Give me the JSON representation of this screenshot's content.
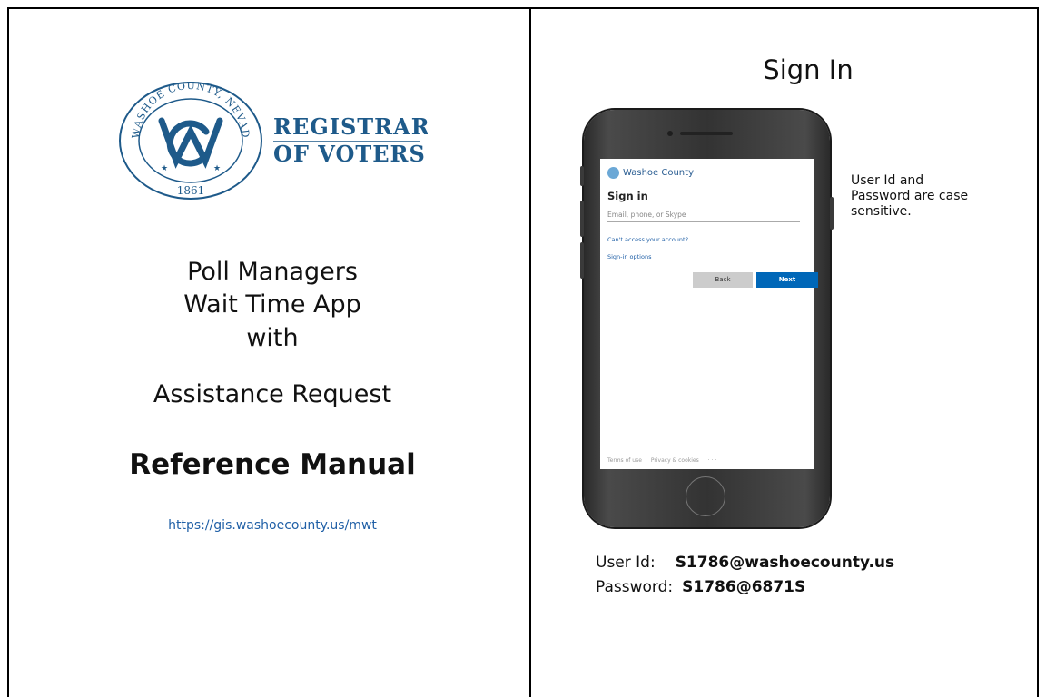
{
  "left_panel": {
    "logo": {
      "arc_text": "WASHOE COUNTY, NEVADA",
      "year": "1861",
      "org_line1": "REGISTRAR",
      "org_line2": "OF VOTERS",
      "brand_color": "#1e5a8a"
    },
    "title_lines": [
      "Poll Managers",
      "Wait Time App",
      "with",
      "Assistance Request"
    ],
    "subtitle": "Reference Manual",
    "url": "https://gis.washoecounty.us/mwt"
  },
  "right_panel": {
    "heading": "Sign In",
    "note": "User Id and Password are case sensitive.",
    "phone_screen": {
      "org": "Washoe County",
      "heading": "Sign in",
      "input_placeholder": "Email, phone, or Skype",
      "link_cant_access": "Can't access your account?",
      "link_signin_options": "Sign-in options",
      "back_label": "Back",
      "next_label": "Next",
      "footer_terms": "Terms of use",
      "footer_privacy": "Privacy & cookies",
      "footer_more": "· · ·"
    },
    "credentials": {
      "user_label": "User Id:",
      "user_value": "S1786@washoecounty.us",
      "password_label": "Password:",
      "password_value": "S1786@6871S"
    }
  }
}
